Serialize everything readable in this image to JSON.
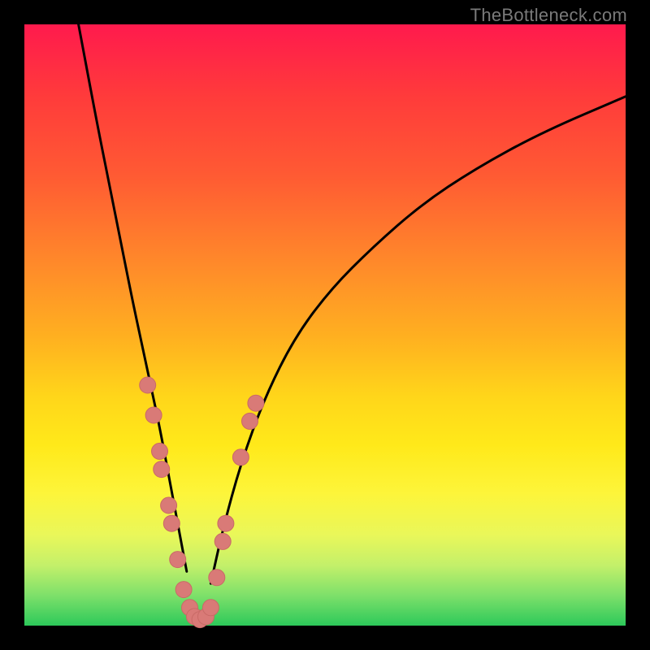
{
  "watermark": "TheBottleneck.com",
  "colors": {
    "frame": "#000000",
    "curve": "#000000",
    "marker_fill": "#d97a77",
    "marker_stroke": "#c96a66"
  },
  "chart_data": {
    "type": "line",
    "title": "",
    "xlabel": "",
    "ylabel": "",
    "xlim": [
      0,
      100
    ],
    "ylim": [
      0,
      100
    ],
    "grid": false,
    "legend": false,
    "series": [
      {
        "name": "left-branch",
        "x": [
          9,
          12,
          14,
          16,
          18,
          19.5,
          21,
          22.5,
          24,
          25.5,
          27
        ],
        "values": [
          100,
          84,
          74,
          64,
          54,
          47,
          40,
          33,
          25,
          17,
          9
        ]
      },
      {
        "name": "right-branch",
        "x": [
          31,
          33,
          36,
          40,
          45,
          51,
          58,
          66,
          75,
          86,
          100
        ],
        "values": [
          7,
          16,
          27,
          38,
          48,
          56,
          63,
          70,
          76,
          82,
          88
        ]
      },
      {
        "name": "valley-floor",
        "x": [
          27,
          28,
          29,
          30,
          31
        ],
        "values": [
          2,
          1,
          0.5,
          1,
          2
        ]
      }
    ],
    "markers": {
      "name": "highlight-points",
      "points": [
        {
          "x": 20.5,
          "y": 40
        },
        {
          "x": 21.5,
          "y": 35
        },
        {
          "x": 22.5,
          "y": 29
        },
        {
          "x": 22.8,
          "y": 26
        },
        {
          "x": 24.0,
          "y": 20
        },
        {
          "x": 24.5,
          "y": 17
        },
        {
          "x": 25.5,
          "y": 11
        },
        {
          "x": 26.5,
          "y": 6
        },
        {
          "x": 27.5,
          "y": 3
        },
        {
          "x": 28.3,
          "y": 1.5
        },
        {
          "x": 29.2,
          "y": 1
        },
        {
          "x": 30.2,
          "y": 1.5
        },
        {
          "x": 31.0,
          "y": 3
        },
        {
          "x": 32.0,
          "y": 8
        },
        {
          "x": 33.0,
          "y": 14
        },
        {
          "x": 33.5,
          "y": 17
        },
        {
          "x": 36.0,
          "y": 28
        },
        {
          "x": 37.5,
          "y": 34
        },
        {
          "x": 38.5,
          "y": 37
        }
      ]
    }
  }
}
